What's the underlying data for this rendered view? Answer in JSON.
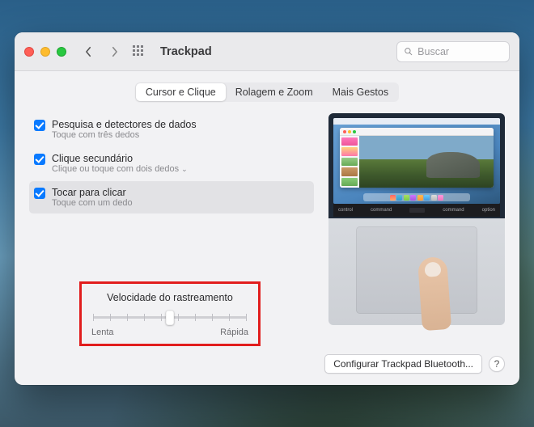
{
  "window": {
    "title": "Trackpad",
    "search_placeholder": "Buscar"
  },
  "tabs": [
    {
      "label": "Cursor e Clique",
      "selected": true
    },
    {
      "label": "Rolagem e Zoom",
      "selected": false
    },
    {
      "label": "Mais Gestos",
      "selected": false
    }
  ],
  "options": [
    {
      "title": "Pesquisa e detectores de dados",
      "subtitle": "Toque com três dedos",
      "checked": true,
      "has_menu": false
    },
    {
      "title": "Clique secundário",
      "subtitle": "Clique ou toque com dois dedos",
      "checked": true,
      "has_menu": true
    },
    {
      "title": "Tocar para clicar",
      "subtitle": "Toque com um dedo",
      "checked": true,
      "has_menu": false,
      "highlighted": true
    }
  ],
  "tracking_speed": {
    "title": "Velocidade do rastreamento",
    "min_label": "Lenta",
    "max_label": "Rápida",
    "ticks": 10,
    "value_index": 4
  },
  "keyboard_keys": {
    "left1": "control",
    "left2": "command",
    "right1": "command",
    "right2": "option"
  },
  "footer": {
    "bluetooth_button": "Configurar Trackpad Bluetooth...",
    "help": "?"
  },
  "colors": {
    "accent": "#0a7aff",
    "highlight_box": "#e11d1d"
  }
}
